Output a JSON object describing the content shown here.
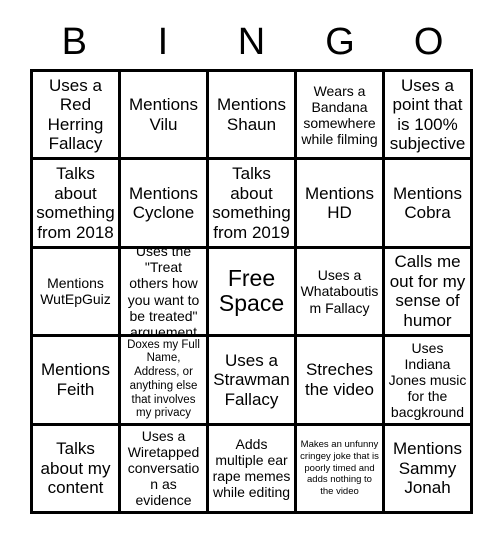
{
  "card": {
    "title_letters": [
      "B",
      "I",
      "N",
      "G",
      "O"
    ],
    "rows": [
      [
        {
          "text": "Uses a Red Herring Fallacy",
          "size": "lg"
        },
        {
          "text": "Mentions Vilu",
          "size": "lg"
        },
        {
          "text": "Mentions Shaun",
          "size": "lg"
        },
        {
          "text": "Wears a Bandana somewhere while filming",
          "size": "md"
        },
        {
          "text": "Uses a point that is 100% subjective",
          "size": "lg"
        }
      ],
      [
        {
          "text": "Talks about something from 2018",
          "size": "lg"
        },
        {
          "text": "Mentions Cyclone",
          "size": "lg"
        },
        {
          "text": "Talks about something from 2019",
          "size": "lg"
        },
        {
          "text": "Mentions HD",
          "size": "lg"
        },
        {
          "text": "Mentions Cobra",
          "size": "lg"
        }
      ],
      [
        {
          "text": "Mentions WutEpGuiz",
          "size": "md"
        },
        {
          "text": "Uses the \"Treat others how you want to be treated\" arguement",
          "size": "md"
        },
        {
          "text": "Free Space",
          "size": "xl"
        },
        {
          "text": "Uses a Whataboutism Fallacy",
          "size": "md"
        },
        {
          "text": "Calls me out for my sense of humor",
          "size": "lg"
        }
      ],
      [
        {
          "text": "Mentions Feith",
          "size": "lg"
        },
        {
          "text": "Doxes my Full Name, Address, or anything else that involves my privacy",
          "size": "sm"
        },
        {
          "text": "Uses a Strawman Fallacy",
          "size": "lg"
        },
        {
          "text": "Streches the video",
          "size": "lg"
        },
        {
          "text": "Uses Indiana Jones music for the bacgkround",
          "size": "md"
        }
      ],
      [
        {
          "text": "Talks about my content",
          "size": "lg"
        },
        {
          "text": "Uses a Wiretapped conversation as evidence",
          "size": "md"
        },
        {
          "text": "Adds multiple ear rape memes while editing",
          "size": "md"
        },
        {
          "text": "Makes an unfunny cringey joke that is poorly timed and adds nothing to the video",
          "size": "xs"
        },
        {
          "text": "Mentions Sammy Jonah",
          "size": "lg"
        }
      ]
    ]
  },
  "colors": {
    "background": "#ffffff",
    "grid_line": "#000000",
    "text": "#000000"
  }
}
